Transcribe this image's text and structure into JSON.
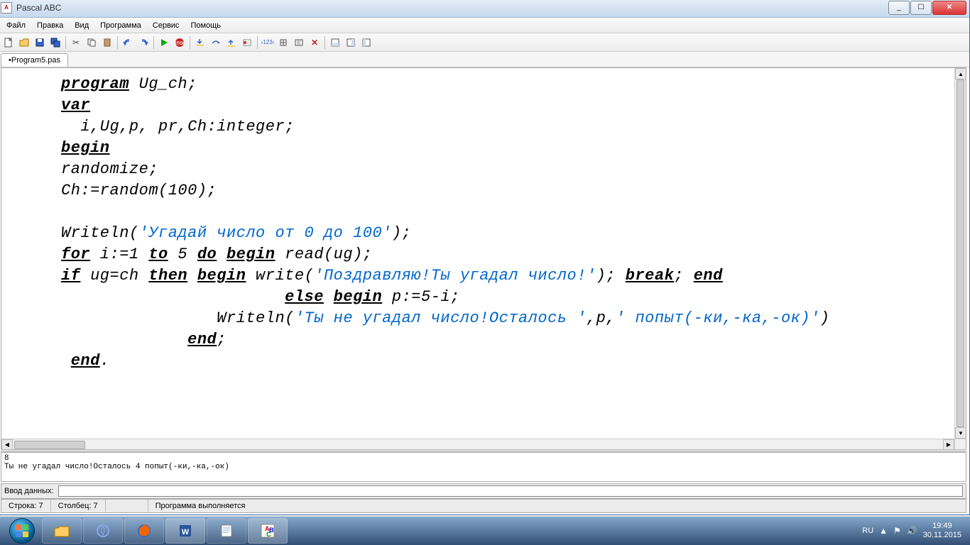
{
  "window": {
    "title": "Pascal ABC",
    "minimize": "_",
    "maximize": "☐",
    "close": "✕"
  },
  "menu": [
    "Файл",
    "Правка",
    "Вид",
    "Программа",
    "Сервис",
    "Помощь"
  ],
  "toolbar_icons": {
    "new": "new-file-icon",
    "open": "open-file-icon",
    "save": "save-icon",
    "saveall": "save-all-icon",
    "cut": "cut-icon",
    "copy": "copy-icon",
    "paste": "paste-icon",
    "undo": "undo-icon",
    "redo": "redo-icon",
    "run": "run-icon",
    "stop": "stop-icon",
    "stepinto": "step-into-icon",
    "stepover": "step-over-icon",
    "stepout": "step-out-icon",
    "toggle-bp": "breakpoint-icon",
    "watch": "watch-icon",
    "trace": "trace-icon",
    "codecomp": "codecomplete-icon",
    "delete-bp": "delete-bp-icon",
    "panel1": "panel1-icon",
    "panel2": "panel2-icon",
    "panel3": "panel3-icon"
  },
  "file_tab": "•Program5.pas",
  "code": {
    "l1a": "program",
    "l1b": " Ug_ch;",
    "l2a": "var",
    "l3": "  i,Ug,p, pr,Ch:integer;",
    "l4a": "begin",
    "l5": "randomize;",
    "l6": "Ch:=random(100);",
    "l8a": "Writeln(",
    "l8s": "'Угадай число от 0 до 100'",
    "l8b": ");",
    "l9a": "for",
    "l9b": " i:=1 ",
    "l9c": "to",
    "l9d": " 5 ",
    "l9e": "do",
    "l9f": " ",
    "l9g": "begin",
    "l9h": " read(ug);",
    "l10a": "if",
    "l10b": " ug=ch ",
    "l10c": "then",
    "l10d": " ",
    "l10e": "begin",
    "l10f": " write(",
    "l10s": "'Поздравляю!Ты угадал число!'",
    "l10g": "); ",
    "l10h": "break",
    "l10i": "; ",
    "l10j": "end",
    "l11a": "                       ",
    "l11b": "else",
    "l11c": " ",
    "l11d": "begin",
    "l11e": " p:=5-i;",
    "l12a": "                Writeln(",
    "l12s1": "'Ты не угадал число!Осталось '",
    "l12b": ",p,",
    "l12s2": "' попыт(-ки,-ка,-ок)'",
    "l12c": ")",
    "l13a": "             ",
    "l13b": "end",
    "l13c": ";",
    "l14a": " ",
    "l14b": "end",
    "l14c": "."
  },
  "output": "8\nТы не угадал число!Осталось 4 попыт(-ки,-ка,-ок)",
  "input_label": "Ввод данных:",
  "status": {
    "line": "Строка: 7",
    "col": "Столбец: 7",
    "msg": "Программа выполняется"
  },
  "tray": {
    "lang": "RU",
    "time": "19:49",
    "date": "30.11.2015"
  }
}
